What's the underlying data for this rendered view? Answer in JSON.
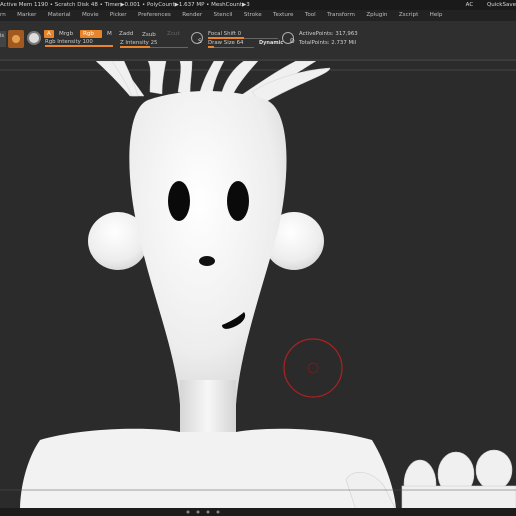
{
  "status": {
    "text": "Active Mem 1190 • Scratch Disk 48 •  Timer▶0.001 • PolyCount▶1.637 MP  • MeshCount▶3",
    "right_items": [
      "AC",
      "QuickSave"
    ]
  },
  "menu": [
    "rn",
    "Marker",
    "Material",
    "Movie",
    "Picker",
    "Preferences",
    "Render",
    "Stencil",
    "Stroke",
    "Texture",
    "Tool",
    "Transform",
    "Zplugin",
    "Zscript",
    "Help"
  ],
  "toolbar": {
    "side_label": "is",
    "a_label": "A",
    "mrgb_label": "Mrgb",
    "rgb_label": "Rgb",
    "m_label": "M",
    "zadd_label": "Zadd",
    "zsub_label": "Zsub",
    "zcut_label": "Zcut",
    "rgb_intensity": "Rgb Intensity 100",
    "z_intensity": "Z Intensity 25",
    "focal_shift": "Focal Shift 0",
    "draw_size": "Draw Size 64",
    "dynamic_label": "Dynamic",
    "s_label": "S",
    "d_label": "D",
    "active_points": "ActivePoints: 317,963",
    "total_points": "TotalPoints: 2.737 Mil"
  },
  "colors": {
    "accent": "#e8852a",
    "brush_cursor": "#b02020",
    "model": "#f2f2f2",
    "background": "#2b2b2b"
  }
}
